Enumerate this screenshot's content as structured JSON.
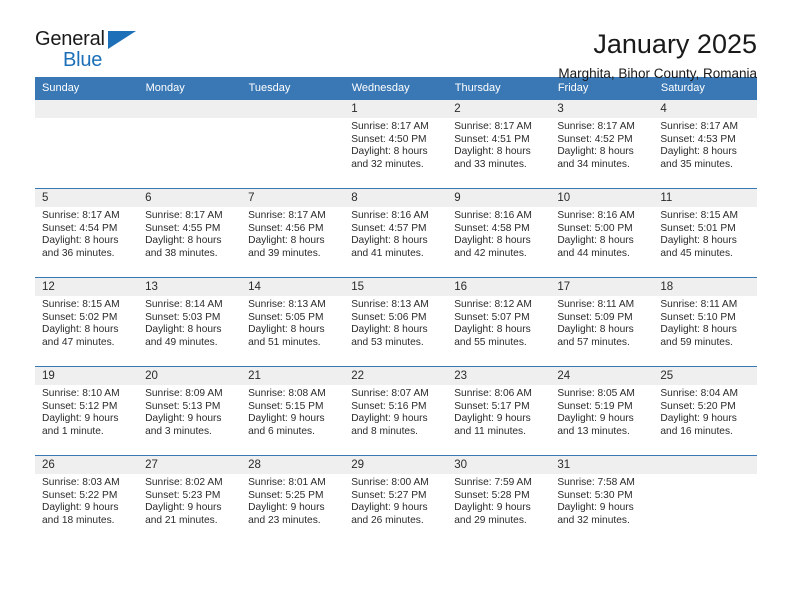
{
  "brand": {
    "name_top": "General",
    "name_bottom": "Blue",
    "accent_color": "#1d70b8"
  },
  "header": {
    "title": "January 2025",
    "subtitle": "Marghita, Bihor County, Romania"
  },
  "theme": {
    "header_bg": "#3a78b5",
    "daynum_bg": "#efefef",
    "text": "#2b2b2b"
  },
  "calendar": {
    "weekday_headers": [
      "Sunday",
      "Monday",
      "Tuesday",
      "Wednesday",
      "Thursday",
      "Friday",
      "Saturday"
    ],
    "weeks": [
      [
        {
          "day": "",
          "lines": []
        },
        {
          "day": "",
          "lines": []
        },
        {
          "day": "",
          "lines": []
        },
        {
          "day": "1",
          "lines": [
            "Sunrise: 8:17 AM",
            "Sunset: 4:50 PM",
            "Daylight: 8 hours",
            "and 32 minutes."
          ]
        },
        {
          "day": "2",
          "lines": [
            "Sunrise: 8:17 AM",
            "Sunset: 4:51 PM",
            "Daylight: 8 hours",
            "and 33 minutes."
          ]
        },
        {
          "day": "3",
          "lines": [
            "Sunrise: 8:17 AM",
            "Sunset: 4:52 PM",
            "Daylight: 8 hours",
            "and 34 minutes."
          ]
        },
        {
          "day": "4",
          "lines": [
            "Sunrise: 8:17 AM",
            "Sunset: 4:53 PM",
            "Daylight: 8 hours",
            "and 35 minutes."
          ]
        }
      ],
      [
        {
          "day": "5",
          "lines": [
            "Sunrise: 8:17 AM",
            "Sunset: 4:54 PM",
            "Daylight: 8 hours",
            "and 36 minutes."
          ]
        },
        {
          "day": "6",
          "lines": [
            "Sunrise: 8:17 AM",
            "Sunset: 4:55 PM",
            "Daylight: 8 hours",
            "and 38 minutes."
          ]
        },
        {
          "day": "7",
          "lines": [
            "Sunrise: 8:17 AM",
            "Sunset: 4:56 PM",
            "Daylight: 8 hours",
            "and 39 minutes."
          ]
        },
        {
          "day": "8",
          "lines": [
            "Sunrise: 8:16 AM",
            "Sunset: 4:57 PM",
            "Daylight: 8 hours",
            "and 41 minutes."
          ]
        },
        {
          "day": "9",
          "lines": [
            "Sunrise: 8:16 AM",
            "Sunset: 4:58 PM",
            "Daylight: 8 hours",
            "and 42 minutes."
          ]
        },
        {
          "day": "10",
          "lines": [
            "Sunrise: 8:16 AM",
            "Sunset: 5:00 PM",
            "Daylight: 8 hours",
            "and 44 minutes."
          ]
        },
        {
          "day": "11",
          "lines": [
            "Sunrise: 8:15 AM",
            "Sunset: 5:01 PM",
            "Daylight: 8 hours",
            "and 45 minutes."
          ]
        }
      ],
      [
        {
          "day": "12",
          "lines": [
            "Sunrise: 8:15 AM",
            "Sunset: 5:02 PM",
            "Daylight: 8 hours",
            "and 47 minutes."
          ]
        },
        {
          "day": "13",
          "lines": [
            "Sunrise: 8:14 AM",
            "Sunset: 5:03 PM",
            "Daylight: 8 hours",
            "and 49 minutes."
          ]
        },
        {
          "day": "14",
          "lines": [
            "Sunrise: 8:13 AM",
            "Sunset: 5:05 PM",
            "Daylight: 8 hours",
            "and 51 minutes."
          ]
        },
        {
          "day": "15",
          "lines": [
            "Sunrise: 8:13 AM",
            "Sunset: 5:06 PM",
            "Daylight: 8 hours",
            "and 53 minutes."
          ]
        },
        {
          "day": "16",
          "lines": [
            "Sunrise: 8:12 AM",
            "Sunset: 5:07 PM",
            "Daylight: 8 hours",
            "and 55 minutes."
          ]
        },
        {
          "day": "17",
          "lines": [
            "Sunrise: 8:11 AM",
            "Sunset: 5:09 PM",
            "Daylight: 8 hours",
            "and 57 minutes."
          ]
        },
        {
          "day": "18",
          "lines": [
            "Sunrise: 8:11 AM",
            "Sunset: 5:10 PM",
            "Daylight: 8 hours",
            "and 59 minutes."
          ]
        }
      ],
      [
        {
          "day": "19",
          "lines": [
            "Sunrise: 8:10 AM",
            "Sunset: 5:12 PM",
            "Daylight: 9 hours",
            "and 1 minute."
          ]
        },
        {
          "day": "20",
          "lines": [
            "Sunrise: 8:09 AM",
            "Sunset: 5:13 PM",
            "Daylight: 9 hours",
            "and 3 minutes."
          ]
        },
        {
          "day": "21",
          "lines": [
            "Sunrise: 8:08 AM",
            "Sunset: 5:15 PM",
            "Daylight: 9 hours",
            "and 6 minutes."
          ]
        },
        {
          "day": "22",
          "lines": [
            "Sunrise: 8:07 AM",
            "Sunset: 5:16 PM",
            "Daylight: 9 hours",
            "and 8 minutes."
          ]
        },
        {
          "day": "23",
          "lines": [
            "Sunrise: 8:06 AM",
            "Sunset: 5:17 PM",
            "Daylight: 9 hours",
            "and 11 minutes."
          ]
        },
        {
          "day": "24",
          "lines": [
            "Sunrise: 8:05 AM",
            "Sunset: 5:19 PM",
            "Daylight: 9 hours",
            "and 13 minutes."
          ]
        },
        {
          "day": "25",
          "lines": [
            "Sunrise: 8:04 AM",
            "Sunset: 5:20 PM",
            "Daylight: 9 hours",
            "and 16 minutes."
          ]
        }
      ],
      [
        {
          "day": "26",
          "lines": [
            "Sunrise: 8:03 AM",
            "Sunset: 5:22 PM",
            "Daylight: 9 hours",
            "and 18 minutes."
          ]
        },
        {
          "day": "27",
          "lines": [
            "Sunrise: 8:02 AM",
            "Sunset: 5:23 PM",
            "Daylight: 9 hours",
            "and 21 minutes."
          ]
        },
        {
          "day": "28",
          "lines": [
            "Sunrise: 8:01 AM",
            "Sunset: 5:25 PM",
            "Daylight: 9 hours",
            "and 23 minutes."
          ]
        },
        {
          "day": "29",
          "lines": [
            "Sunrise: 8:00 AM",
            "Sunset: 5:27 PM",
            "Daylight: 9 hours",
            "and 26 minutes."
          ]
        },
        {
          "day": "30",
          "lines": [
            "Sunrise: 7:59 AM",
            "Sunset: 5:28 PM",
            "Daylight: 9 hours",
            "and 29 minutes."
          ]
        },
        {
          "day": "31",
          "lines": [
            "Sunrise: 7:58 AM",
            "Sunset: 5:30 PM",
            "Daylight: 9 hours",
            "and 32 minutes."
          ]
        },
        {
          "day": "",
          "lines": []
        }
      ]
    ]
  }
}
